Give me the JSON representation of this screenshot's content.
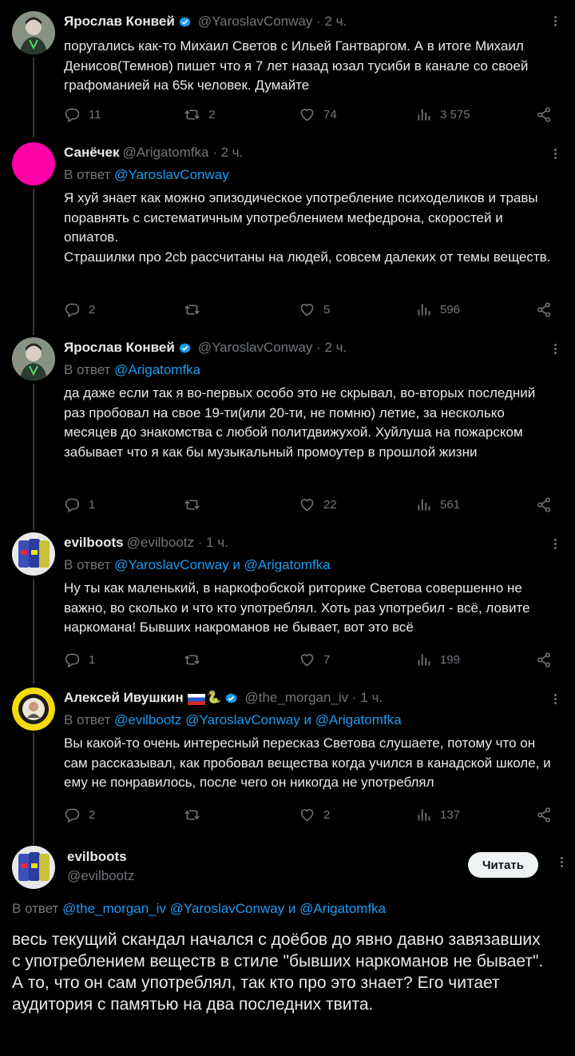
{
  "colors": {
    "background": "#000000",
    "text": "#e7e9ea",
    "muted": "#71767b",
    "link": "#1d9bf0",
    "verified": "#1d9bf0"
  },
  "icons": [
    "reply-icon",
    "retweet-icon",
    "like-icon",
    "views-icon",
    "share-icon",
    "more-icon",
    "verified-icon"
  ],
  "tweets": [
    {
      "name": "Ярослав Конвей",
      "handle": "@YaroslavConway",
      "sep": " · ",
      "time": "2 ч.",
      "reply_prefix": "",
      "reply_to": [],
      "text": "поругались как-то Михаил Светов с Ильей Гантваргом. А в итоге Михаил Денисов(Темнов) пишет что я 7 лет назад юзал тусиби в канале со своей графоманией на 65к человек. Думайте",
      "stats": {
        "replies": "11",
        "retweets": "2",
        "likes": "74",
        "views": "3 575"
      }
    },
    {
      "name": "Санёчек",
      "handle": "@Arigatomfka",
      "sep": " · ",
      "time": "2 ч.",
      "reply_prefix": "В ответ ",
      "reply_to": [
        "@YaroslavConway"
      ],
      "text": "Я хуй знает как можно эпизодическое употребление психоделиков и травы поравнять с систематичным употреблением мефедрона, скоростей и опиатов.\nСтрашилки про 2cb рассчитаны на людей, совсем далеких от темы веществ.",
      "stats": {
        "replies": "2",
        "retweets": "",
        "likes": "5",
        "views": "596"
      }
    },
    {
      "name": "Ярослав Конвей",
      "handle": "@YaroslavConway",
      "sep": " · ",
      "time": "2 ч.",
      "reply_prefix": "В ответ ",
      "reply_to": [
        "@Arigatomfka"
      ],
      "text": "да даже если так я во-первых особо это не скрывал, во-вторых последний раз пробовал на свое 19-ти(или 20-ти, не помню) летие, за несколько месяцев до знакомства с любой политдвижухой. Хуйлуша на пожарском забывает что я как бы музыкальный промоутер в прошлой жизни",
      "stats": {
        "replies": "1",
        "retweets": "",
        "likes": "22",
        "views": "561"
      }
    },
    {
      "name": "evilboots",
      "handle": "@evilbootz",
      "sep": " · ",
      "time": "1 ч.",
      "reply_prefix": "В ответ ",
      "reply_to": [
        "@YaroslavConway и @Arigatomfka"
      ],
      "text": "Ну ты как маленький, в наркофобской риторике Светова совершенно не важно, во сколько и что кто употреблял. Хоть раз употребил - всё, ловите наркомана! Бывших накроманов не бывает, вот это всё",
      "stats": {
        "replies": "1",
        "retweets": "",
        "likes": "7",
        "views": "199"
      }
    },
    {
      "name": "Алексей Ивушкин",
      "handle": "@the_morgan_iv",
      "sep": " · ",
      "time": "1 ч.",
      "reply_prefix": "В ответ ",
      "reply_to": [
        "@evilbootz @YaroslavConway и @Arigatomfka"
      ],
      "text": "Вы какой-то очень интересный пересказ Светова слушаете, потому что он сам рассказывал, как пробовал вещества когда учился в канадской школе, и ему не понравилось, после чего он никогда не употреблял",
      "stats": {
        "replies": "2",
        "retweets": "",
        "likes": "2",
        "views": "137"
      }
    }
  ],
  "main_tweet": {
    "name": "evilboots",
    "handle": "@evilbootz",
    "follow_label": "Читать",
    "reply_prefix": "В ответ ",
    "reply_to": "@the_morgan_iv @YaroslavConway и @Arigatomfka",
    "text": "весь текущий скандал начался с доёбов до явно давно завязавших с употреблением веществ в стиле \"бывших наркоманов не бывает\". А то, что он сам употреблял, так кто про это знает? Его читает аудитория с памятью на два последних твита."
  }
}
